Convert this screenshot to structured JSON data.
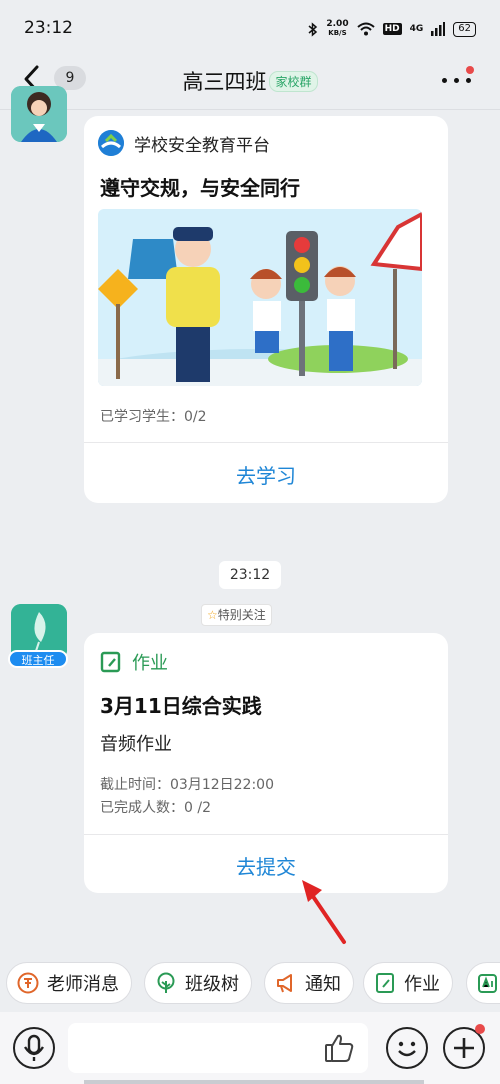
{
  "status_bar": {
    "time": "23:12",
    "net_speed_value": "2.00",
    "net_speed_unit": "KB/S",
    "hd_label": "HD",
    "signal_label": "4G",
    "battery": "62"
  },
  "nav": {
    "unread_count": "9",
    "title": "高三四班",
    "group_tag": "家校群"
  },
  "messages": [
    {
      "platform_name": "学校安全教育平台",
      "title": "遵守交规，与安全同行",
      "stats": "已学习学生：0/2",
      "action": "去学习"
    }
  ],
  "timestamp": "23:12",
  "special_tag": "特别关注",
  "sender_role": "班主任",
  "homework": {
    "label": "作业",
    "title": "3月11日综合实践",
    "type": "音频作业",
    "deadline": "截止时间：03月12日22:00",
    "completed": "已完成人数：0 /2",
    "action": "去提交"
  },
  "quick_actions": [
    {
      "label": "老师消息",
      "icon": "teacher-icon"
    },
    {
      "label": "班级树",
      "icon": "tree-icon"
    },
    {
      "label": "通知",
      "icon": "megaphone-icon"
    },
    {
      "label": "作业",
      "icon": "homework-icon"
    }
  ],
  "colors": {
    "accent_blue": "#1f86d6",
    "homework_green": "#2a9a55",
    "teacher_orange": "#e0662a",
    "badge_blue": "#1d8cf0",
    "annotation_red": "#e02424"
  }
}
